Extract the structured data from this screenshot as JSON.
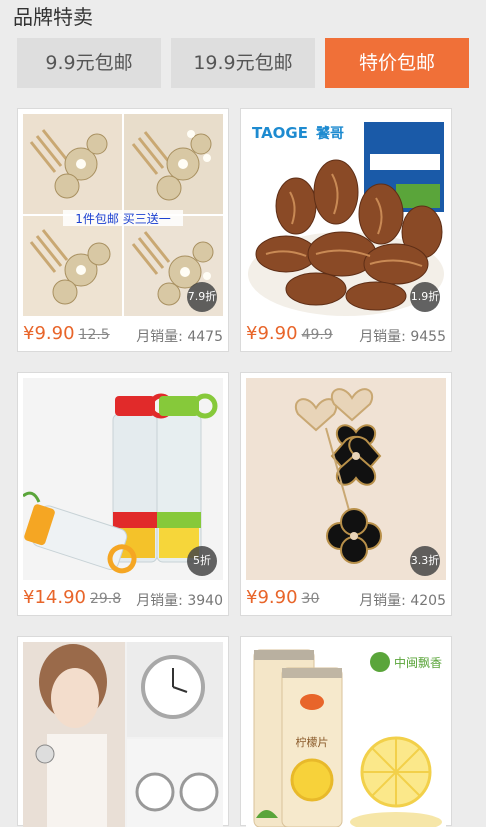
{
  "header": {
    "title": "品牌特卖"
  },
  "tabs": [
    {
      "label": "9.9元包邮"
    },
    {
      "label": "19.9元包邮"
    },
    {
      "label": "特价包邮"
    }
  ],
  "products": [
    {
      "price": "¥9.90",
      "orig_price": "12.5",
      "sales_label": "月销量:",
      "sales": "4475",
      "discount": "7.9折",
      "banner": "1件包邮 买三送一"
    },
    {
      "price": "¥9.90",
      "orig_price": "49.9",
      "sales_label": "月销量:",
      "sales": "9455",
      "discount": "1.9折",
      "brand": "TAOGE",
      "brand_cn": "饕哥"
    },
    {
      "price": "¥14.90",
      "orig_price": "29.8",
      "sales_label": "月销量:",
      "sales": "3940",
      "discount": "5折"
    },
    {
      "price": "¥9.90",
      "orig_price": "30",
      "sales_label": "月销量:",
      "sales": "4205",
      "discount": "3.3折"
    },
    {
      "brand_cn": "中闽飘香",
      "label": "柠檬片"
    }
  ],
  "colors": {
    "accent": "#f07038",
    "price": "#e8652a"
  }
}
